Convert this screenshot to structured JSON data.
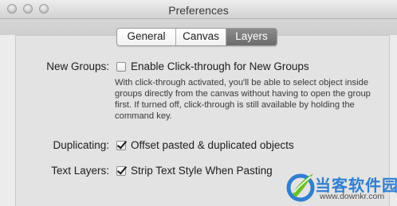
{
  "window": {
    "title": "Preferences"
  },
  "tabs": [
    {
      "label": "General",
      "selected": false
    },
    {
      "label": "Canvas",
      "selected": false
    },
    {
      "label": "Layers",
      "selected": true
    }
  ],
  "settings": {
    "new_groups": {
      "label": "New Groups:",
      "checkbox_label": "Enable Click-through for New Groups",
      "checked": false,
      "description": "With click-through activated, you'll be able to select object inside groups directly from the canvas without having to open the group first. If turned off, click-through is still available by holding the command key."
    },
    "duplicating": {
      "label": "Duplicating:",
      "checkbox_label": "Offset pasted & duplicated objects",
      "checked": true
    },
    "text_layers": {
      "label": "Text Layers:",
      "checkbox_label": "Strip Text Style When Pasting",
      "checked": true
    }
  },
  "watermark": {
    "text": "当客软件园",
    "url": "www.downkr.com"
  },
  "colors": {
    "selected_tab": "#7a7a7a",
    "watermark_blue": "#2f7fd0",
    "watermark_green": "#6cbf2a"
  }
}
